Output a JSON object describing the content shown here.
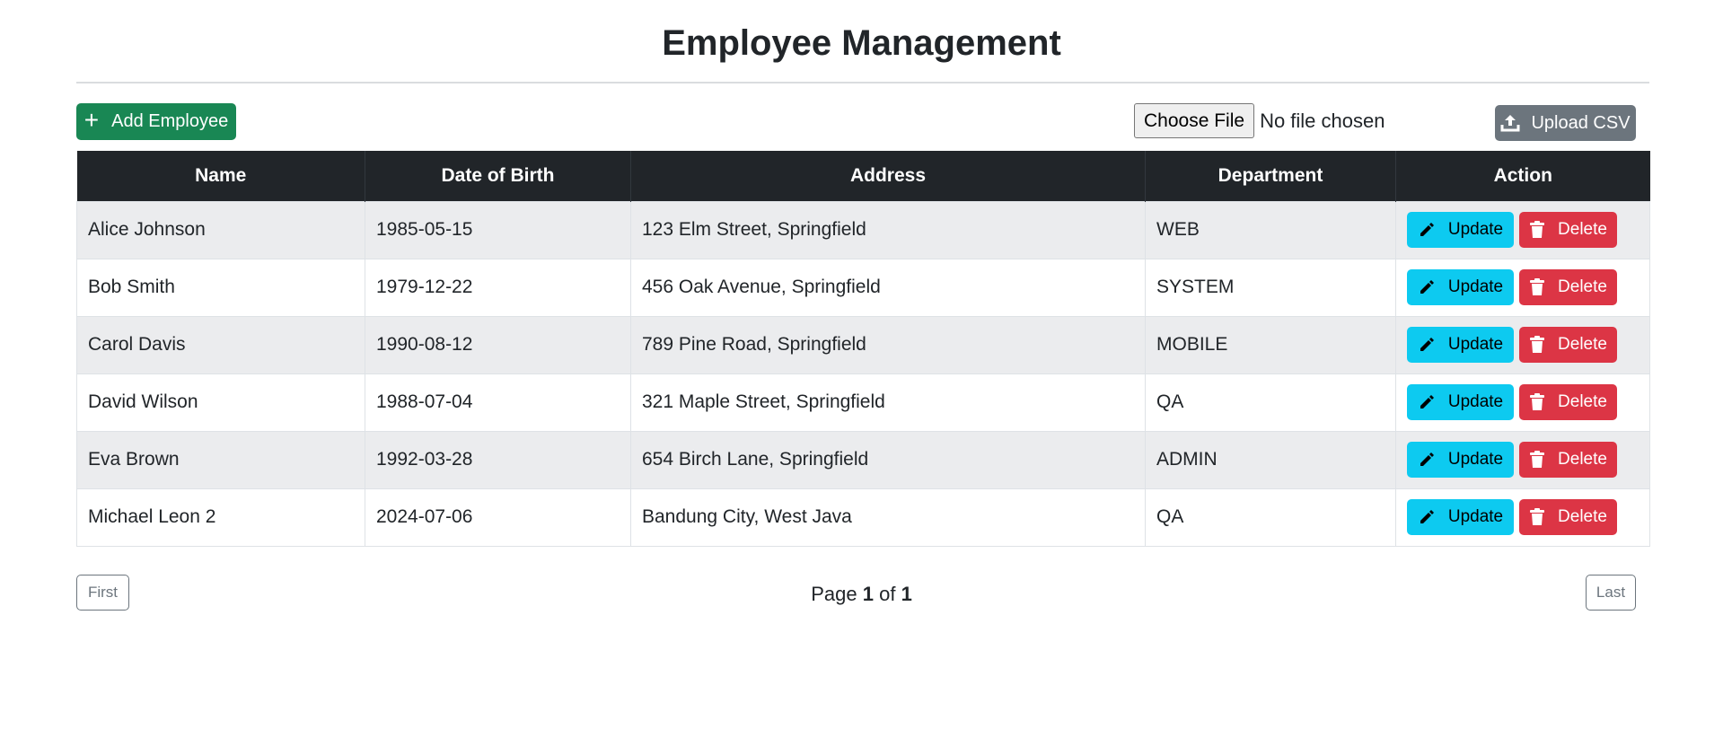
{
  "page": {
    "title": "Employee Management"
  },
  "toolbar": {
    "add_label": "Add Employee",
    "add_icon": "plus-icon",
    "choose_file_label": "Choose File",
    "file_status": "No file chosen",
    "upload_label": "Upload CSV",
    "upload_icon": "upload-icon"
  },
  "table": {
    "headers": [
      "Name",
      "Date of Birth",
      "Address",
      "Department",
      "Action"
    ],
    "rows": [
      {
        "name": "Alice Johnson",
        "dob": "1985-05-15",
        "address": "123 Elm Street, Springfield",
        "department": "WEB"
      },
      {
        "name": "Bob Smith",
        "dob": "1979-12-22",
        "address": "456 Oak Avenue, Springfield",
        "department": "SYSTEM"
      },
      {
        "name": "Carol Davis",
        "dob": "1990-08-12",
        "address": "789 Pine Road, Springfield",
        "department": "MOBILE"
      },
      {
        "name": "David Wilson",
        "dob": "1988-07-04",
        "address": "321 Maple Street, Springfield",
        "department": "QA"
      },
      {
        "name": "Eva Brown",
        "dob": "1992-03-28",
        "address": "654 Birch Lane, Springfield",
        "department": "ADMIN"
      },
      {
        "name": "Michael Leon 2",
        "dob": "2024-07-06",
        "address": "Bandung City, West Java",
        "department": "QA"
      }
    ],
    "update_label": "Update",
    "delete_label": "Delete",
    "update_icon": "pencil-icon",
    "delete_icon": "trash-icon"
  },
  "pagination": {
    "first_label": "First",
    "last_label": "Last",
    "page_word": "Page",
    "current": "1",
    "of_word": "of",
    "total": "1"
  },
  "colors": {
    "add": "#198754",
    "upload": "#6c757d",
    "update": "#0dcaf0",
    "delete": "#dc3545",
    "header_bg": "#212529"
  }
}
